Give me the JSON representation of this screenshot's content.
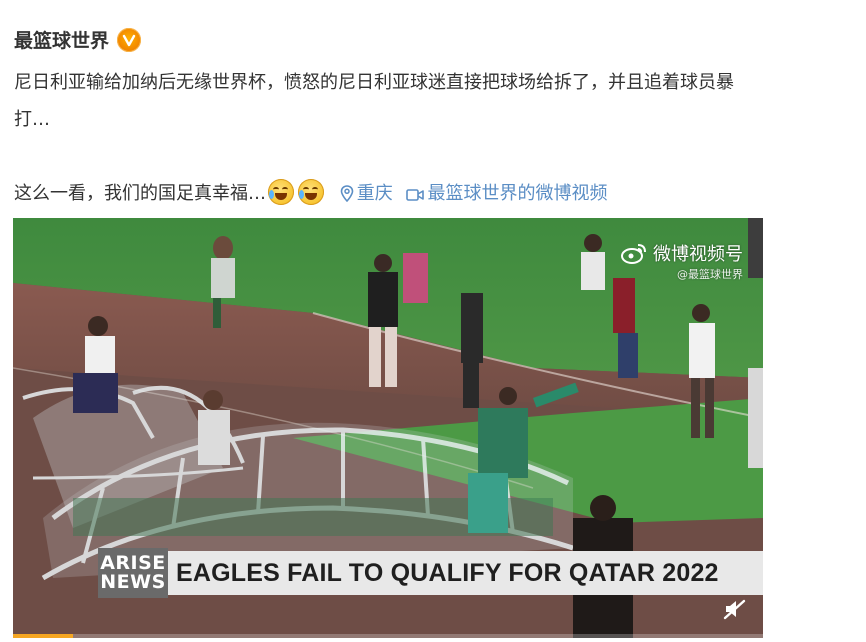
{
  "author": {
    "name": "最篮球世界"
  },
  "post": {
    "line1": "尼日利亚输给加纳后无缘世界杯，愤怒的尼日利亚球迷直接把球场给拆了，并且追着球员暴",
    "line2": "打…",
    "line3_text": "这么一看，我们的国足真幸福…",
    "emoji_names": [
      "laugh-cry-emoji",
      "laugh-cry-emoji"
    ],
    "location_label": "重庆",
    "video_link_label": "最篮球世界的微博视频"
  },
  "video": {
    "watermark_main": "微博视频号",
    "watermark_sub": "@最篮球世界",
    "logo_top": "ARISE",
    "logo_bottom": "NEWS",
    "headline": "EAGLES FAIL TO QUALIFY FOR QATAR 2022",
    "progress": 0.08,
    "mute_icon": "mute-icon"
  },
  "colors": {
    "link": "#5b8ec5",
    "text": "#333333",
    "badge": "#f08200",
    "progress": "#f5a623"
  }
}
